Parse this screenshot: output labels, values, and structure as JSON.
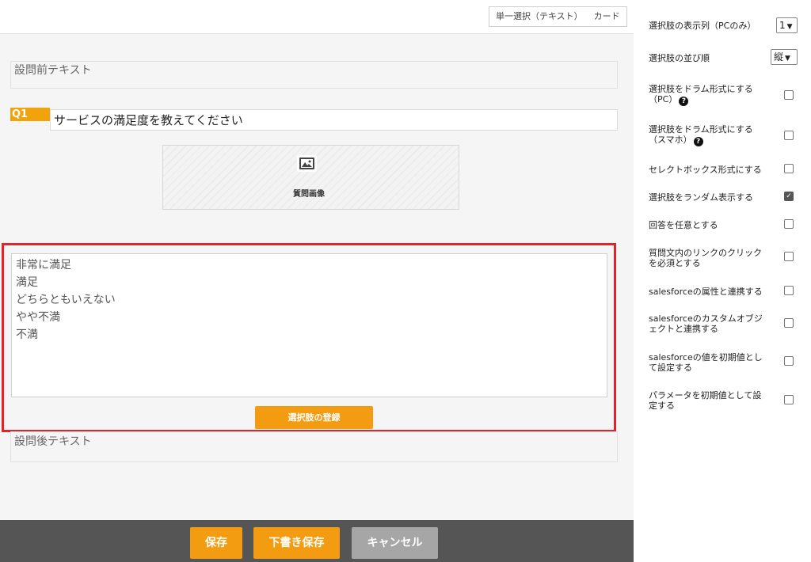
{
  "header": {
    "type_tabs": [
      "単一選択（テキスト）",
      "カード"
    ]
  },
  "editor": {
    "pre_text": "設問前テキスト",
    "question_number": "Q1",
    "question_title": "サービスの満足度を教えてください",
    "image_label": "質問画像",
    "choices": [
      "非常に満足",
      "満足",
      "どちらともいえない",
      "やや不満",
      "不満"
    ],
    "register_button": "選択肢の登録",
    "post_text": "設問後テキスト"
  },
  "footer": {
    "save": "保存",
    "draft": "下書き保存",
    "cancel": "キャンセル"
  },
  "settings": {
    "columns_label": "選択肢の表示列（PCのみ）",
    "columns_value": "1",
    "order_label": "選択肢の並び順",
    "order_value": "縦",
    "drum_pc_line1": "選択肢をドラム形式にする",
    "drum_pc_line2": "（PC）",
    "drum_sp_line1": "選択肢をドラム形式にする",
    "drum_sp_line2": "（スマホ）",
    "selectbox": "セレクトボックス形式にする",
    "random": "選択肢をランダム表示する",
    "optional": "回答を任意とする",
    "link_click_line1": "質問文内のリンクのクリック",
    "link_click_line2": "を必須とする",
    "sf_attr": "salesforceの属性と連携する",
    "sf_custom_line1": "salesforceのカスタムオブジ",
    "sf_custom_line2": "ェクトと連携する",
    "sf_initial_line1": "salesforceの値を初期値とし",
    "sf_initial_line2": "て設定する",
    "param_line1": "パラメータを初期値として設",
    "param_line2": "定する",
    "random_checked": true
  },
  "colors": {
    "accent": "#f39c12",
    "highlight_border": "#e3222a",
    "footer_bg": "#555555"
  }
}
